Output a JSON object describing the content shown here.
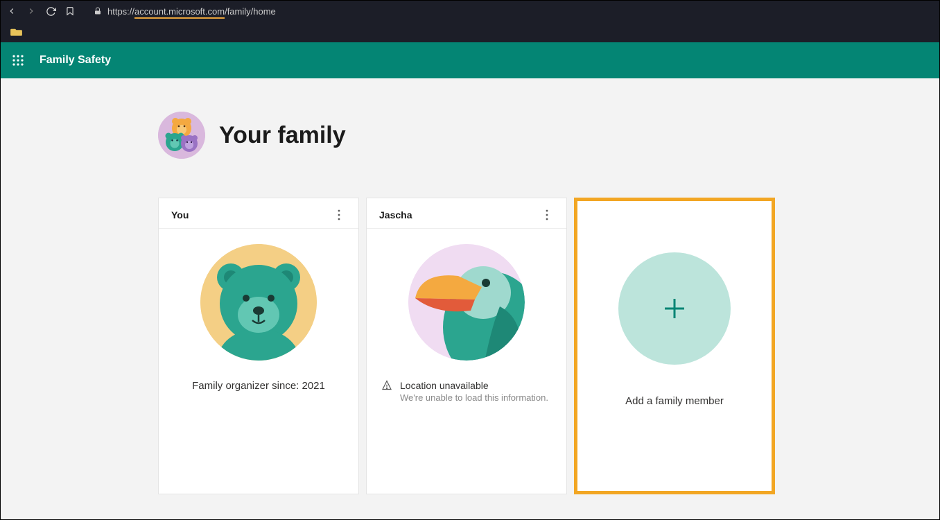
{
  "browser": {
    "url_protocol": "https://",
    "url_domain": "account.microsoft.com",
    "url_path": "/family/home"
  },
  "header": {
    "app_title": "Family Safety"
  },
  "page": {
    "title": "Your family"
  },
  "cards": {
    "you": {
      "name": "You",
      "subtitle": "Family organizer since: 2021"
    },
    "member1": {
      "name": "Jascha",
      "status_title": "Location unavailable",
      "status_subtitle": "We're unable to load this information."
    },
    "add": {
      "label": "Add a family member"
    }
  }
}
